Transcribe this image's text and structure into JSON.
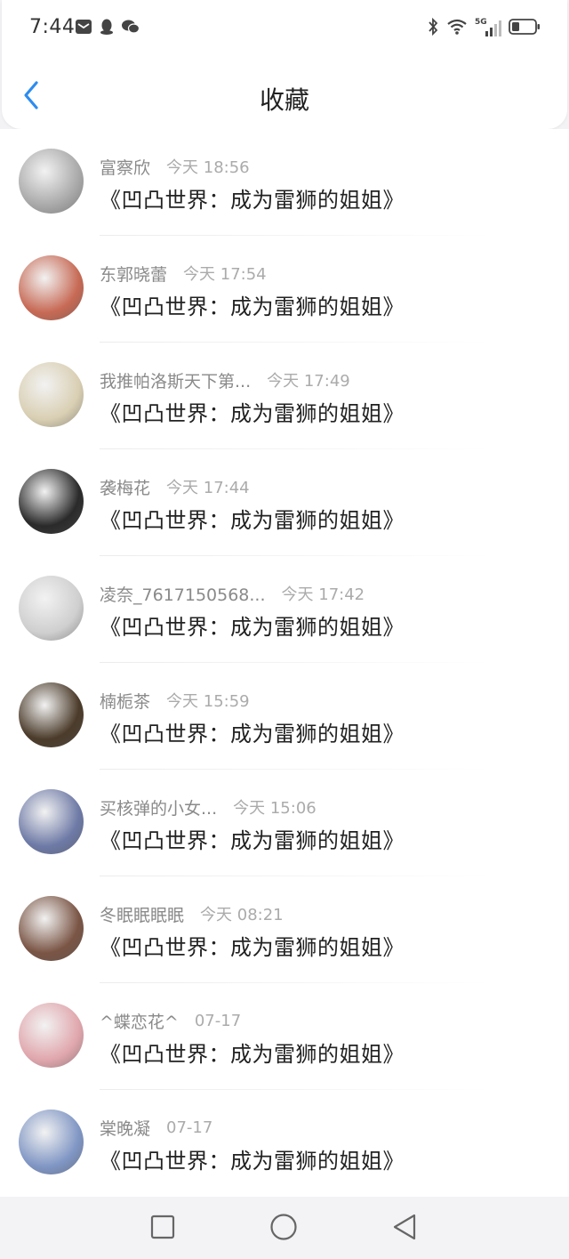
{
  "status_bar": {
    "time": "7:44",
    "left_icons": [
      "mail-icon",
      "qq-icon",
      "wechat-icon"
    ],
    "right_icons": [
      "bluetooth-icon",
      "wifi-icon",
      "signal-5g-icon",
      "battery-icon"
    ],
    "network_label": "5G"
  },
  "header": {
    "title": "收藏",
    "back_icon": "chevron-left-icon",
    "accent_color": "#2d8cf0"
  },
  "favorites": [
    {
      "user": "富察欣",
      "time": "今天 18:56",
      "title": "《凹凸世界：成为雷狮的姐姐》",
      "avatar_color": "#a9a9a9"
    },
    {
      "user": "东郭晓蕾",
      "time": "今天 17:54",
      "title": "《凹凸世界：成为雷狮的姐姐》",
      "avatar_color": "#c76a55"
    },
    {
      "user": "我推帕洛斯天下第...",
      "time": "今天 17:49",
      "title": "《凹凸世界：成为雷狮的姐姐》",
      "avatar_color": "#d9cfb3"
    },
    {
      "user": "袭梅花",
      "time": "今天 17:44",
      "title": "《凹凸世界：成为雷狮的姐姐》",
      "avatar_color": "#2a2a2a"
    },
    {
      "user": "凌奈_7617150568...",
      "time": "今天 17:42",
      "title": "《凹凸世界：成为雷狮的姐姐》",
      "avatar_color": "#cfcfcf"
    },
    {
      "user": "楠栀茶",
      "time": "今天 15:59",
      "title": "《凹凸世界：成为雷狮的姐姐》",
      "avatar_color": "#4b3b2a"
    },
    {
      "user": "买核弹的小女...",
      "time": "今天 15:06",
      "title": "《凹凸世界：成为雷狮的姐姐》",
      "avatar_color": "#6e7aa6"
    },
    {
      "user": "冬眠眠眠眠",
      "time": "今天 08:21",
      "title": "《凹凸世界：成为雷狮的姐姐》",
      "avatar_color": "#7a5545"
    },
    {
      "user": "^蝶恋花^",
      "time": "07-17",
      "title": "《凹凸世界：成为雷狮的姐姐》",
      "avatar_color": "#e0a7ad"
    },
    {
      "user": "棠晚凝",
      "time": "07-17",
      "title": "《凹凸世界：成为雷狮的姐姐》",
      "avatar_color": "#8096c4"
    }
  ],
  "nav_bar": {
    "buttons": [
      "recents-square-icon",
      "home-circle-icon",
      "back-triangle-icon"
    ]
  }
}
